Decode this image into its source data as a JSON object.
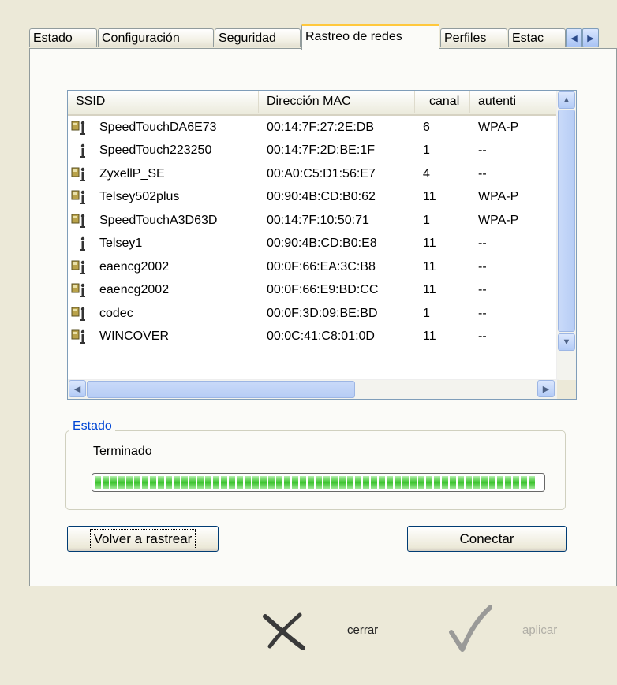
{
  "tabs": [
    {
      "label": "Estado",
      "active": false
    },
    {
      "label": "Configuración",
      "active": false
    },
    {
      "label": "Seguridad",
      "active": false
    },
    {
      "label": "Rastreo de redes",
      "active": true
    },
    {
      "label": "Perfiles",
      "active": false
    },
    {
      "label": "Estac",
      "active": false
    }
  ],
  "list": {
    "columns": [
      "SSID",
      "Dirección MAC",
      "canal",
      "autenti"
    ],
    "rows": [
      {
        "ssid": "SpeedTouchDA6E73",
        "mac": "00:14:7F:27:2E:DB",
        "channel": "6",
        "auth": "WPA-P",
        "icon": "secured-network-icon"
      },
      {
        "ssid": "SpeedTouch223250",
        "mac": "00:14:7F:2D:BE:1F",
        "channel": "1",
        "auth": "--",
        "icon": "open-network-icon"
      },
      {
        "ssid": "ZyxellP_SE",
        "mac": "00:A0:C5:D1:56:E7",
        "channel": "4",
        "auth": "--",
        "icon": "secured-network-icon"
      },
      {
        "ssid": "Telsey502plus",
        "mac": "00:90:4B:CD:B0:62",
        "channel": "11",
        "auth": "WPA-P",
        "icon": "secured-network-icon"
      },
      {
        "ssid": "SpeedTouchA3D63D",
        "mac": "00:14:7F:10:50:71",
        "channel": "1",
        "auth": "WPA-P",
        "icon": "secured-network-icon"
      },
      {
        "ssid": "Telsey1",
        "mac": "00:90:4B:CD:B0:E8",
        "channel": "11",
        "auth": "--",
        "icon": "open-network-icon"
      },
      {
        "ssid": "eaencg2002",
        "mac": "00:0F:66:EA:3C:B8",
        "channel": "11",
        "auth": "--",
        "icon": "secured-network-icon"
      },
      {
        "ssid": "eaencg2002",
        "mac": "00:0F:66:E9:BD:CC",
        "channel": "11",
        "auth": "--",
        "icon": "secured-network-icon"
      },
      {
        "ssid": "codec",
        "mac": "00:0F:3D:09:BE:BD",
        "channel": "1",
        "auth": "--",
        "icon": "secured-network-icon"
      },
      {
        "ssid": "WINCOVER",
        "mac": "00:0C:41:C8:01:0D",
        "channel": "11",
        "auth": "--",
        "icon": "secured-network-icon"
      }
    ]
  },
  "status_group": {
    "title": "Estado",
    "text": "Terminado",
    "progress": 1.0
  },
  "buttons": {
    "rescan": "Volver a rastrear",
    "connect": "Conectar"
  },
  "footer": {
    "close_label": "cerrar",
    "apply_label": "aplicar"
  },
  "colors": {
    "window_bg": "#ece9d8",
    "tab_highlight": "#ffc83c",
    "group_title": "#0046d5",
    "progress_green": "#39c22b"
  }
}
